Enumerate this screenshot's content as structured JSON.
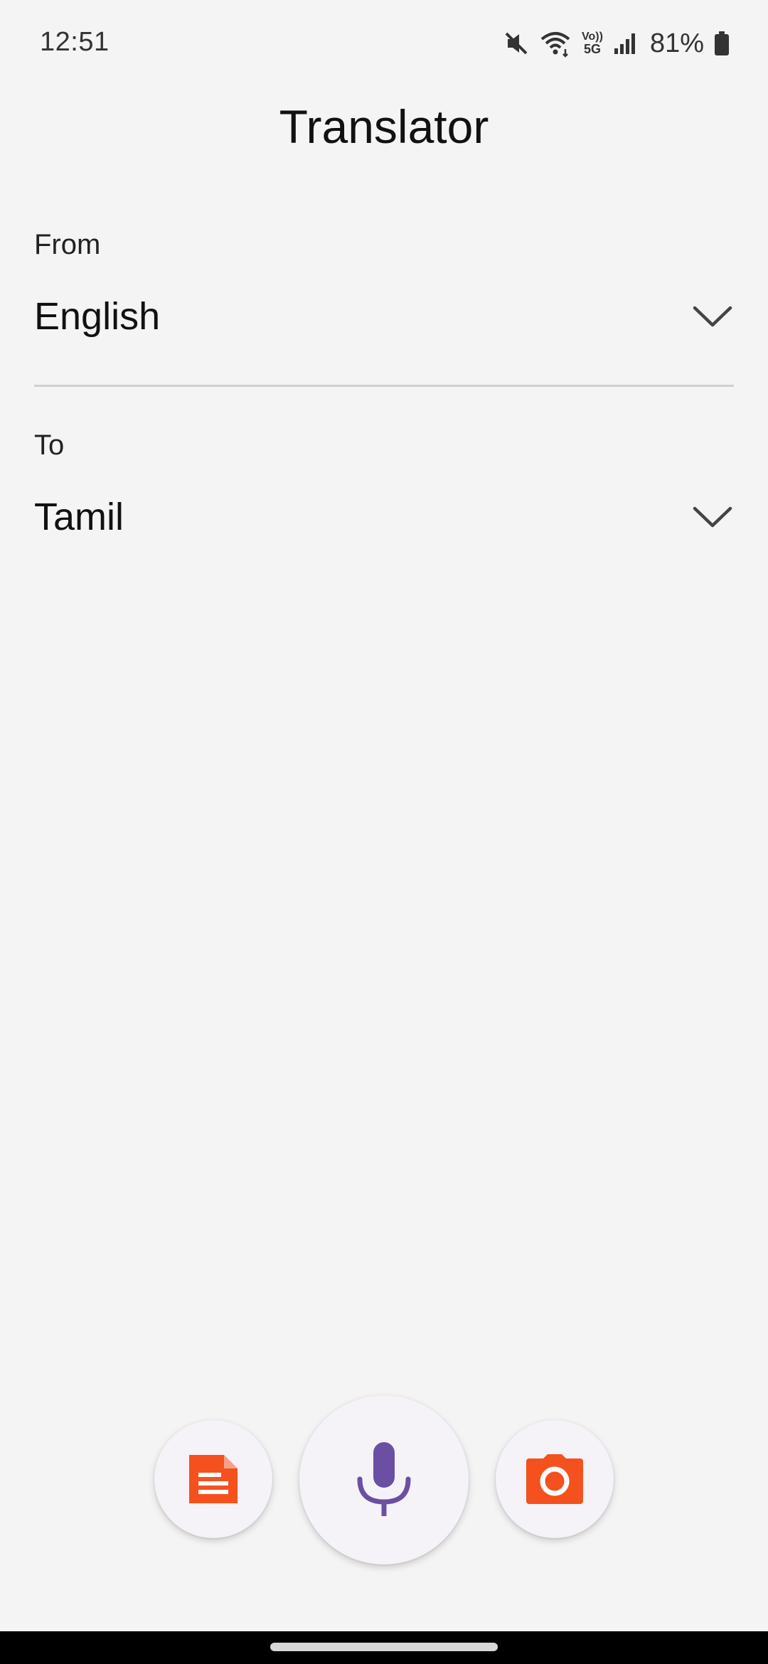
{
  "status_bar": {
    "time": "12:51",
    "battery_percent": "81%",
    "network_label_top": "Vo))",
    "network_label_bottom": "5G"
  },
  "header": {
    "title": "Translator"
  },
  "from": {
    "label": "From",
    "language": "English"
  },
  "to": {
    "label": "To",
    "language": "Tamil"
  },
  "actions": {
    "text_input_icon": "document-icon",
    "voice_input_icon": "microphone-icon",
    "camera_input_icon": "camera-icon"
  },
  "colors": {
    "accent_orange": "#f4511e",
    "accent_purple": "#6a4fa3",
    "background": "#f4f4f4",
    "fab_background": "#f5f2f8"
  }
}
